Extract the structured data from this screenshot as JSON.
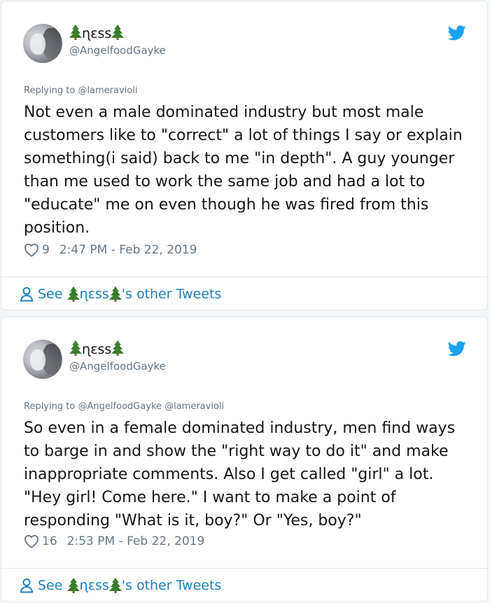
{
  "tweets": [
    {
      "display_name": "ɳɛss",
      "handle": "@AngelfoodGayke",
      "replying_label": "Replying to",
      "replying_to": "@lameravioli",
      "text": "Not even a male dominated industry but most male customers like to \"correct\" a lot of things I say or explain something(i said) back to me \"in depth\". A guy younger than me used to work the same job and had a lot to \"educate\" me on even though he was fired from this position.",
      "likes": "9",
      "timestamp": "2:47 PM - Feb 22, 2019",
      "see_prefix": "See",
      "see_name": "ɳɛss",
      "see_suffix": "'s other Tweets"
    },
    {
      "display_name": "ɳɛss",
      "handle": "@AngelfoodGayke",
      "replying_label": "Replying to",
      "replying_to": "@AngelfoodGayke @lameravioli",
      "text": "So even in a female dominated industry, men find ways to barge in and show the \"right way to do it\" and make inappropriate comments. Also I get called \"girl\" a lot. \"Hey girl! Come here.\" I want to make a point of responding \"What is it, boy?\" Or \"Yes, boy?\"",
      "likes": "16",
      "timestamp": "2:53 PM - Feb 22, 2019",
      "see_prefix": "See",
      "see_name": "ɳɛss",
      "see_suffix": "'s other Tweets"
    }
  ],
  "icons": {
    "name_decoration": "evergreen-tree-emoji",
    "platform": "twitter-bird",
    "like": "heart-outline",
    "profile": "person-outline"
  },
  "colors": {
    "twitter_blue": "#1da1f2",
    "link_blue": "#1b7fbf",
    "muted_text": "#657786",
    "tree_green": "#3a7d2c"
  }
}
